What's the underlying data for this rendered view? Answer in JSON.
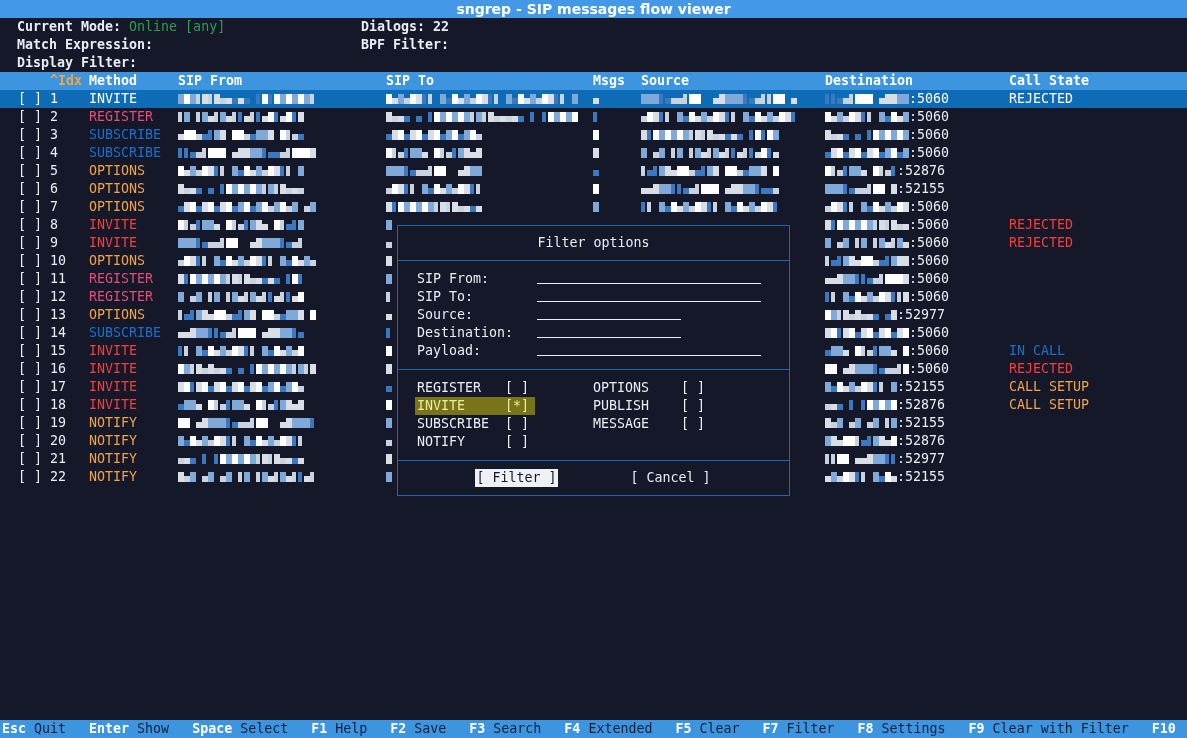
{
  "window": {
    "title": "sngrep - SIP messages flow viewer"
  },
  "info": [
    {
      "label": "Current Mode:",
      "value": "Online [any]"
    },
    {
      "label": "Dialogs:",
      "value": "22"
    },
    {
      "label": "Match Expression:"
    },
    {
      "label": "BPF Filter:"
    },
    {
      "label": "Display Filter:"
    }
  ],
  "table": {
    "columns": [
      {
        "label": "^Idx",
        "sorted": true
      },
      {
        "label": "Method",
        "sorted": false
      },
      {
        "label": "SIP From",
        "sorted": false
      },
      {
        "label": "SIP To",
        "sorted": false
      },
      {
        "label": "Msgs",
        "sorted": false
      },
      {
        "label": "Source",
        "sorted": false
      },
      {
        "label": "Destination",
        "sorted": false
      },
      {
        "label": "Call State",
        "sorted": false
      }
    ],
    "rows": [
      {
        "kind": "full",
        "checkbox": "[ ]",
        "checked": false,
        "idx": "1",
        "method": "INVITE",
        "color": "#ffffff",
        "selected": true,
        "port": ":5060",
        "state": {
          "label": "REJECTED",
          "color": "#ffffff"
        }
      },
      {
        "kind": "full",
        "checkbox": "[ ]",
        "checked": false,
        "idx": "2",
        "method": "REGISTER",
        "color": "#e0507a",
        "selected": false,
        "port": ":5060"
      },
      {
        "kind": "full",
        "checkbox": "[ ]",
        "checked": false,
        "idx": "3",
        "method": "SUBSCRIBE",
        "color": "#1f6fc9",
        "selected": false,
        "port": ":5060"
      },
      {
        "kind": "full",
        "checkbox": "[ ]",
        "checked": false,
        "idx": "4",
        "method": "SUBSCRIBE",
        "color": "#1f6fc9",
        "selected": false,
        "port": ":5060"
      },
      {
        "kind": "full",
        "checkbox": "[ ]",
        "checked": false,
        "idx": "5",
        "method": "OPTIONS",
        "color": "#f3a347",
        "selected": false,
        "port": ":52876"
      },
      {
        "kind": "full",
        "checkbox": "[ ]",
        "checked": false,
        "idx": "6",
        "method": "OPTIONS",
        "color": "#f3a347",
        "selected": false,
        "port": ":52155"
      },
      {
        "kind": "full",
        "checkbox": "[ ]",
        "checked": false,
        "idx": "7",
        "method": "OPTIONS",
        "color": "#f3a347",
        "selected": false,
        "port": ":5060"
      },
      {
        "kind": "covered",
        "checkbox": "[ ]",
        "checked": false,
        "idx": "8",
        "method": "INVITE",
        "color": "#f04040",
        "selected": false,
        "port": ":5060",
        "state": {
          "label": "REJECTED",
          "color": "#f04040"
        }
      },
      {
        "kind": "covered",
        "checkbox": "[ ]",
        "checked": false,
        "idx": "9",
        "method": "INVITE",
        "color": "#f04040",
        "selected": false,
        "port": ":5060",
        "state": {
          "label": "REJECTED",
          "color": "#f04040"
        }
      },
      {
        "kind": "covered",
        "checkbox": "[ ]",
        "checked": false,
        "idx": "10",
        "method": "OPTIONS",
        "color": "#f3a347",
        "selected": false,
        "port": ":5060"
      },
      {
        "kind": "covered",
        "checkbox": "[ ]",
        "checked": false,
        "idx": "11",
        "method": "REGISTER",
        "color": "#e0507a",
        "selected": false,
        "port": ":5060"
      },
      {
        "kind": "covered",
        "checkbox": "[ ]",
        "checked": false,
        "idx": "12",
        "method": "REGISTER",
        "color": "#e0507a",
        "selected": false,
        "port": ":5060"
      },
      {
        "kind": "covered",
        "checkbox": "[ ]",
        "checked": false,
        "idx": "13",
        "method": "OPTIONS",
        "color": "#f3a347",
        "selected": false,
        "port": ":52977"
      },
      {
        "kind": "covered",
        "checkbox": "[ ]",
        "checked": false,
        "idx": "14",
        "method": "SUBSCRIBE",
        "color": "#1f6fc9",
        "selected": false,
        "port": ":5060"
      },
      {
        "kind": "covered",
        "checkbox": "[ ]",
        "checked": false,
        "idx": "15",
        "method": "INVITE",
        "color": "#f04040",
        "selected": false,
        "port": ":5060",
        "state": {
          "label": "IN CALL",
          "color": "#1f6fc9"
        }
      },
      {
        "kind": "covered",
        "checkbox": "[ ]",
        "checked": false,
        "idx": "16",
        "method": "INVITE",
        "color": "#f04040",
        "selected": false,
        "port": ":5060",
        "state": {
          "label": "REJECTED",
          "color": "#f04040"
        }
      },
      {
        "kind": "covered",
        "checkbox": "[ ]",
        "checked": false,
        "idx": "17",
        "method": "INVITE",
        "color": "#f04040",
        "selected": false,
        "port": ":52155",
        "state": {
          "label": "CALL SETUP",
          "color": "#f3a347"
        }
      },
      {
        "kind": "covered",
        "checkbox": "[ ]",
        "checked": false,
        "idx": "18",
        "method": "INVITE",
        "color": "#f04040",
        "selected": false,
        "port": ":52876",
        "state": {
          "label": "CALL SETUP",
          "color": "#f3a347"
        }
      },
      {
        "kind": "covered",
        "checkbox": "[ ]",
        "checked": false,
        "idx": "19",
        "method": "NOTIFY",
        "color": "#f3a347",
        "selected": false,
        "port": ":52155"
      },
      {
        "kind": "covered",
        "checkbox": "[ ]",
        "checked": false,
        "idx": "20",
        "method": "NOTIFY",
        "color": "#f3a347",
        "selected": false,
        "port": ":52876"
      },
      {
        "kind": "covered",
        "checkbox": "[ ]",
        "checked": false,
        "idx": "21",
        "method": "NOTIFY",
        "color": "#f3a347",
        "selected": false,
        "port": ":52977"
      },
      {
        "kind": "covered",
        "checkbox": "[ ]",
        "checked": false,
        "idx": "22",
        "method": "NOTIFY",
        "color": "#f3a347",
        "selected": false,
        "port": ":52155"
      }
    ]
  },
  "dialog": {
    "title": "Filter options",
    "fields": [
      {
        "label": "SIP From:",
        "kind": "long"
      },
      {
        "label": "SIP To:",
        "kind": "long"
      },
      {
        "label": "Source:",
        "kind": "short"
      },
      {
        "label": "Destination:",
        "kind": "short"
      },
      {
        "label": "Payload:",
        "kind": "long"
      }
    ],
    "methods": [
      [
        {
          "label": "REGISTER",
          "box": "[ ]",
          "selected": false
        },
        {
          "label": "INVITE",
          "box": "[*]",
          "selected": true
        },
        {
          "label": "SUBSCRIBE",
          "box": "[ ]",
          "selected": false
        },
        {
          "label": "NOTIFY",
          "box": "[ ]",
          "selected": false
        }
      ],
      [
        {
          "label": "OPTIONS",
          "box": "[ ]",
          "selected": false
        },
        {
          "label": "PUBLISH",
          "box": "[ ]",
          "selected": false
        },
        {
          "label": "MESSAGE",
          "box": "[ ]",
          "selected": false
        }
      ]
    ],
    "buttons": [
      {
        "label": "[ Filter ]",
        "selected": true
      },
      {
        "label": "[ Cancel ]",
        "selected": false
      }
    ]
  },
  "footer": [
    {
      "key": "Esc",
      "label": "Quit"
    },
    {
      "key": "Enter",
      "label": "Show"
    },
    {
      "key": "Space",
      "label": "Select"
    },
    {
      "key": "F1",
      "label": "Help"
    },
    {
      "key": "F2",
      "label": "Save"
    },
    {
      "key": "F3",
      "label": "Search"
    },
    {
      "key": "F4",
      "label": "Extended"
    },
    {
      "key": "F5",
      "label": "Clear"
    },
    {
      "key": "F7",
      "label": "Filter"
    },
    {
      "key": "F8",
      "label": "Settings"
    },
    {
      "key": "F9",
      "label": "Clear with Filter"
    },
    {
      "key": "F10"
    }
  ]
}
